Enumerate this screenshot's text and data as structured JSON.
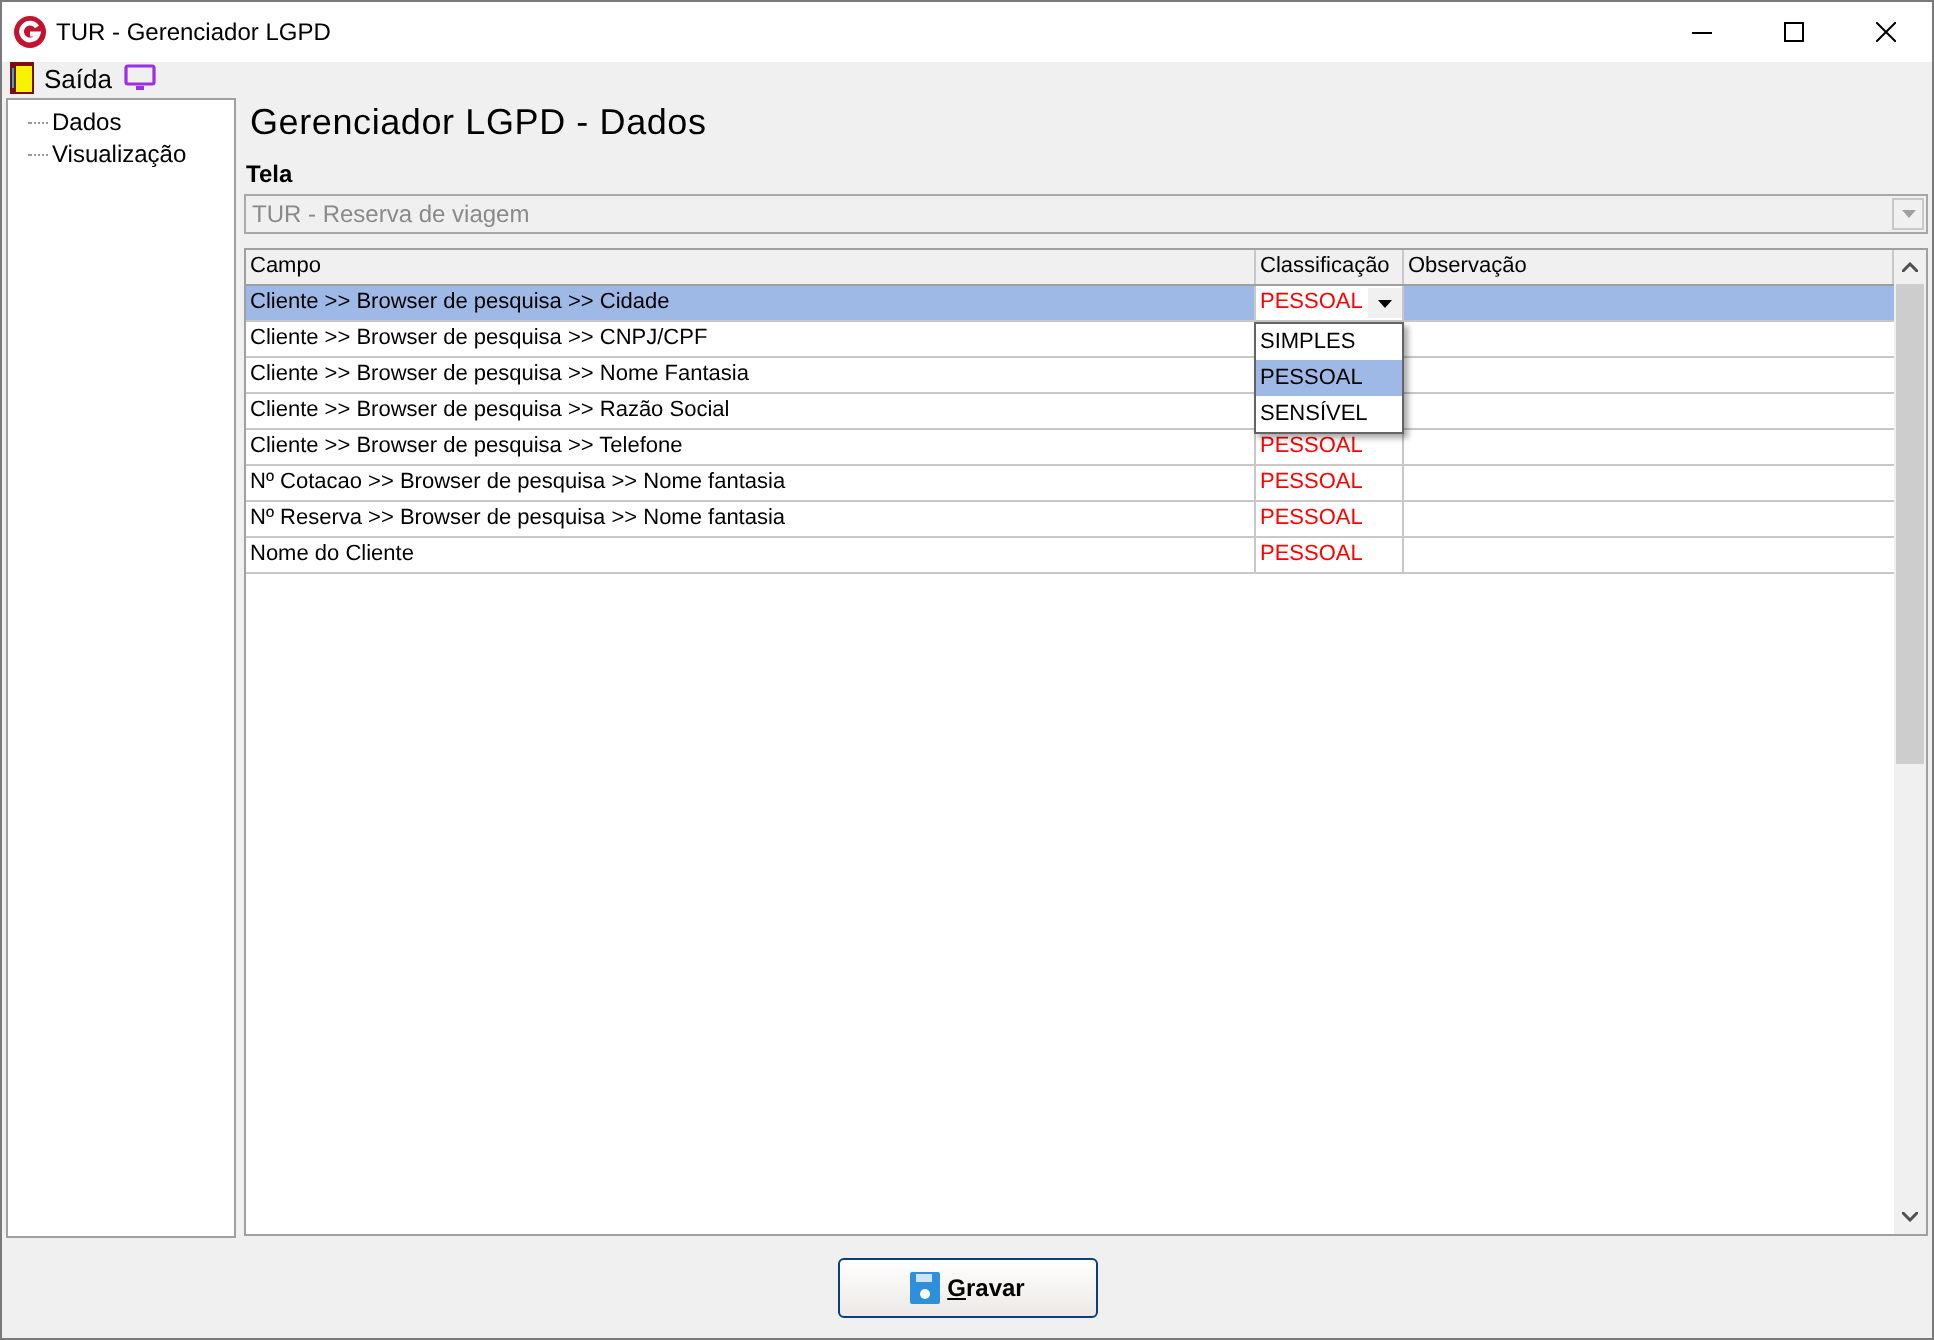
{
  "window": {
    "title": "TUR - Gerenciador LGPD"
  },
  "toolbar": {
    "items": [
      {
        "kind": "exit",
        "label": "Saída"
      },
      {
        "kind": "screen"
      }
    ]
  },
  "sidebar": {
    "items": [
      {
        "label": "Dados",
        "selected": false
      },
      {
        "label": "Visualização",
        "selected": false
      }
    ]
  },
  "heading": "Gerenciador LGPD - Dados",
  "screen_field": {
    "label": "Tela",
    "value": "TUR - Reserva de viagem",
    "disabled": true
  },
  "table": {
    "columns": [
      "Campo",
      "Classificação",
      "Observação"
    ],
    "rows": [
      {
        "campo": "Cliente >> Browser de pesquisa >> Cidade",
        "classificacao": "PESSOAL",
        "selected": true,
        "editing": true
      },
      {
        "campo": "Cliente >> Browser de pesquisa >> CNPJ/CPF",
        "selected": false,
        "editing": false
      },
      {
        "campo": "Cliente >> Browser de pesquisa >> Nome Fantasia",
        "selected": false,
        "editing": false
      },
      {
        "campo": "Cliente >> Browser de pesquisa >> Razão Social",
        "selected": false,
        "editing": false
      },
      {
        "campo": "Cliente >> Browser de pesquisa >> Telefone",
        "classificacao": "PESSOAL",
        "selected": false,
        "editing": false
      },
      {
        "campo": "Nº Cotacao >> Browser de pesquisa >> Nome fantasia",
        "classificacao": "PESSOAL",
        "selected": false,
        "editing": false
      },
      {
        "campo": "Nº Reserva >> Browser de pesquisa >> Nome fantasia",
        "classificacao": "PESSOAL",
        "selected": false,
        "editing": false
      },
      {
        "campo": "Nome do Cliente",
        "classificacao": "PESSOAL",
        "selected": false,
        "editing": false
      }
    ]
  },
  "dropdown": {
    "options": [
      {
        "label": "SIMPLES",
        "selected": false
      },
      {
        "label": "PESSOAL",
        "selected": true
      },
      {
        "label": "SENSÍVEL",
        "selected": false
      }
    ]
  },
  "save_button": {
    "label": "Gravar"
  }
}
